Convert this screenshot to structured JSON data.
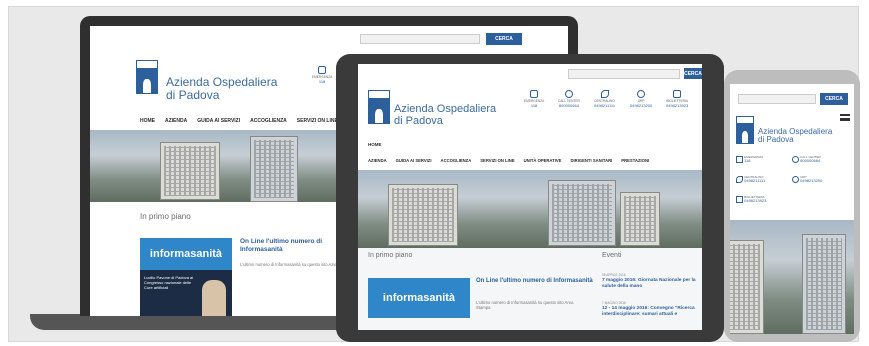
{
  "colors": {
    "brand": "#2d5f9c",
    "news_blue": "#2f86c8"
  },
  "laptop": {
    "search_button": "CERCA",
    "brand_line1": "Azienda Ospedaliera",
    "brand_line2": "di Padova",
    "emergency_label": "EMERGENZA",
    "emergency_num": "118",
    "nav": [
      "HOME",
      "AZIENDA",
      "GUIDA AI SERVIZI",
      "ACCOGLIENZA",
      "SERVIZI ON LINE"
    ],
    "section_title": "In primo piano",
    "news_image_text": "informasanità",
    "news_title": "On Line l'ultimo numero di Informasanità",
    "news_text": "L'ultimo numero di Informasanità su questo sito Azienda",
    "poster_text": "Lucillo Pavone di Padova al Congresso nazionale delle Cure artificiali"
  },
  "tablet": {
    "search_button": "CERCA",
    "brand_line1": "Azienda Ospedaliera",
    "brand_line2": "di Padova",
    "contacts": [
      {
        "label": "EMERGENZA",
        "value": "118",
        "icon": "ambulance-icon"
      },
      {
        "label": "CALL CENTER",
        "value": "800000664",
        "icon": "person-icon"
      },
      {
        "label": "CENTRALINO",
        "value": "0498211111",
        "icon": "phone-icon"
      },
      {
        "label": "URP",
        "value": "0498213200",
        "icon": "chat-icon"
      },
      {
        "label": "BIGLIETTERIA",
        "value": "0498213923",
        "icon": "ticket-icon"
      }
    ],
    "breadcrumb": "HOME",
    "nav": [
      "AZIENDA",
      "GUIDA AI SERVIZI",
      "ACCOGLIENZA",
      "SERVIZI ON LINE",
      "UNITÀ OPERATIVE",
      "DIRIGENTI SANITARI",
      "PRESTAZIONI"
    ],
    "section_title": "In primo piano",
    "events_title": "Eventi",
    "news_image_text": "informasanità",
    "news_title": "On Line l'ultimo numero di Informasanità",
    "news_text": "L'ultimo numero di Informasanità su questo sito Area Stampa",
    "events": [
      {
        "date": "05 APRILE 2016",
        "title": "7 maggio 2016: Giornata Nazionale per la salute della mano"
      },
      {
        "date": "7 MAGGIO 2016",
        "title": "12 - 14 maggio 2016: Convegno \"Ricerca interdisciplinare: sumari attuali e"
      }
    ]
  },
  "phone": {
    "search_button": "CERCA",
    "brand_line1": "Azienda Ospedaliera",
    "brand_line2": "di Padova",
    "contacts": [
      {
        "label": "EMERGENZA",
        "value": "118",
        "icon": "ambulance-icon"
      },
      {
        "label": "CALL CENTER",
        "value": "800000664",
        "icon": "person-icon"
      },
      {
        "label": "CENTRALINO",
        "value": "0498211111",
        "icon": "phone-icon"
      },
      {
        "label": "URP",
        "value": "0498213200",
        "icon": "chat-icon"
      },
      {
        "label": "BIGLIETTERIA",
        "value": "0498213923",
        "icon": "ticket-icon"
      }
    ]
  }
}
